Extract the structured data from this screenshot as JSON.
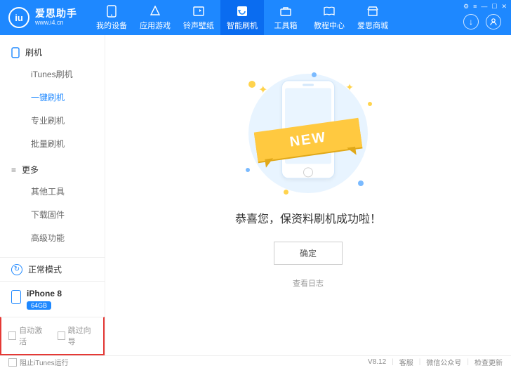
{
  "header": {
    "logo_glyph": "iu",
    "brand": "爱思助手",
    "url": "www.i4.cn",
    "nav": [
      {
        "label": "我的设备"
      },
      {
        "label": "应用游戏"
      },
      {
        "label": "铃声壁纸"
      },
      {
        "label": "智能刷机"
      },
      {
        "label": "工具箱"
      },
      {
        "label": "教程中心"
      },
      {
        "label": "爱思商城"
      }
    ]
  },
  "sidebar": {
    "group1_title": "刷机",
    "group1": [
      {
        "label": "iTunes刷机"
      },
      {
        "label": "一键刷机"
      },
      {
        "label": "专业刷机"
      },
      {
        "label": "批量刷机"
      }
    ],
    "group2_title": "更多",
    "group2": [
      {
        "label": "其他工具"
      },
      {
        "label": "下载固件"
      },
      {
        "label": "高级功能"
      }
    ],
    "mode_label": "正常模式",
    "device_name": "iPhone 8",
    "device_storage": "64GB",
    "auto_activate": "自动激活",
    "skip_guide": "跳过向导"
  },
  "main": {
    "ribbon_text": "NEW",
    "success_msg": "恭喜您，保资料刷机成功啦！",
    "ok_label": "确定",
    "log_label": "查看日志"
  },
  "footer": {
    "block_itunes": "阻止iTunes运行",
    "version": "V8.12",
    "support": "客服",
    "wechat": "微信公众号",
    "update": "检查更新"
  }
}
